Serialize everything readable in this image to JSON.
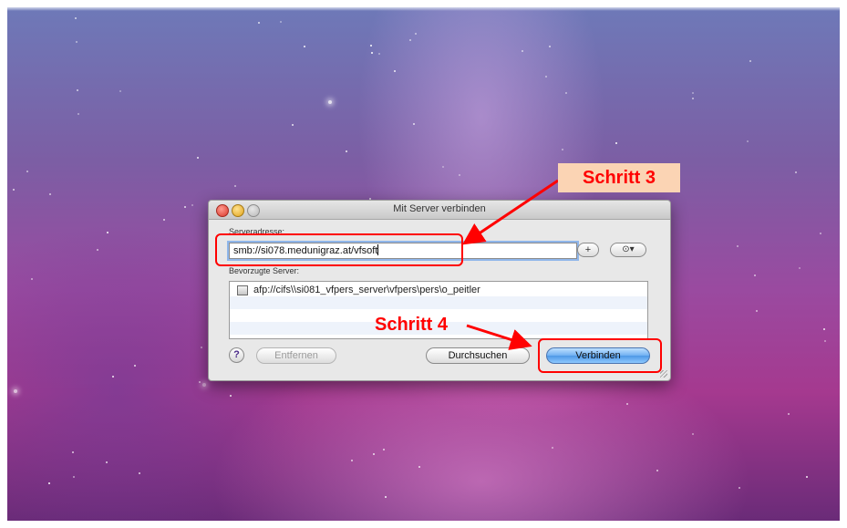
{
  "dialog": {
    "title": "Mit Server verbinden",
    "server_address_label": "Serveradresse:",
    "server_address_value": "smb://si078.medunigraz.at/vfsoft",
    "add_label": "+",
    "history_label": "⊙▾",
    "favorites_label": "Bevorzugte Server:",
    "favorites": [
      {
        "label": "afp://cifs\\\\si081_vfpers_server\\vfpers\\pers\\o_peitler",
        "icon": "server-icon"
      },
      {
        "label": ""
      },
      {
        "label": ""
      },
      {
        "label": ""
      }
    ],
    "help_label": "?",
    "remove_label": "Entfernen",
    "browse_label": "Durchsuchen",
    "connect_label": "Verbinden"
  },
  "annotations": {
    "step3": "Schritt 3",
    "step4": "Schritt 4",
    "color": "#ff0000",
    "box_fill": "#fbd4b4"
  }
}
